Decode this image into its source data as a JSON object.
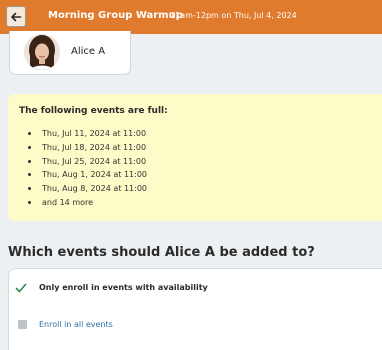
{
  "header": {
    "title": "Morning Group Warmup",
    "subtitle": "11am-12pm on Thu, Jul 4, 2024",
    "back_icon": "arrow-left-icon",
    "color": "#e07a2c"
  },
  "person": {
    "name": "Alice A",
    "avatar_icon": "avatar-photo"
  },
  "full_events": {
    "heading": "The following events are full:",
    "items": [
      "Thu, Jul 11, 2024 at 11:00",
      "Thu, Jul 18, 2024 at 11:00",
      "Thu, Jul 25, 2024 at 11:00",
      "Thu, Aug 1, 2024 at 11:00",
      "Thu, Aug 8, 2024 at 11:00",
      "and 14 more"
    ],
    "background": "#fdfbc7"
  },
  "question": "Which events should Alice A be added to?",
  "options": [
    {
      "label": "Only enroll in events with availability",
      "selected": true,
      "icon": "check-icon"
    },
    {
      "label": "Enroll in all events",
      "selected": false,
      "icon": "checkbox-icon"
    }
  ]
}
